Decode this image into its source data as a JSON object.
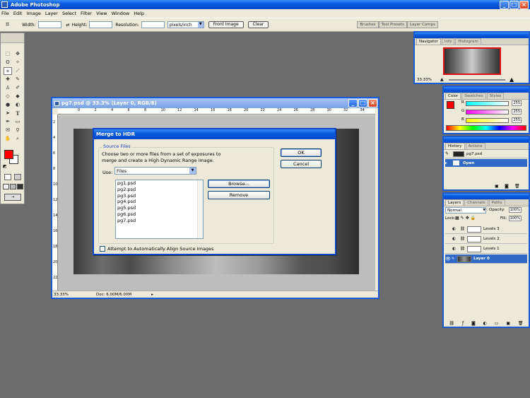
{
  "app": {
    "title": "Adobe Photoshop"
  },
  "menu": [
    "File",
    "Edit",
    "Image",
    "Layer",
    "Select",
    "Filter",
    "View",
    "Window",
    "Help"
  ],
  "options": {
    "width_label": "Width:",
    "height_label": "Height:",
    "resolution_label": "Resolution:",
    "units": "pixels/inch",
    "front_image": "Front Image",
    "clear": "Clear",
    "well_tabs": [
      "Brushes",
      "Tool Presets",
      "Layer Comps"
    ]
  },
  "document": {
    "title": "pg7.psd @ 33.3% (Layer 0, RGB/8)",
    "zoom": "33.33%",
    "doc_info": "Doc: 6.00M/6.00M",
    "ruler_h": [
      "0",
      "2",
      "4",
      "6",
      "8",
      "10",
      "12",
      "14",
      "16",
      "18",
      "20",
      "22",
      "24",
      "26",
      "28",
      "30",
      "32",
      "34"
    ],
    "ruler_v": [
      "2",
      "4",
      "6",
      "8",
      "10",
      "12",
      "14",
      "16",
      "18",
      "20",
      "22"
    ]
  },
  "dialog": {
    "title": "Merge to HDR",
    "group_label": "Source Files",
    "instructions": "Choose two or more files from a set of exposures to merge and create a High Dynamic Range image.",
    "use_label": "Use:",
    "use_value": "Files",
    "files": [
      "pg1.psd",
      "pg2.psd",
      "pg3.psd",
      "pg4.psd",
      "pg5.psd",
      "pg6.psd",
      "pg7.psd"
    ],
    "browse": "Browse...",
    "remove": "Remove",
    "ok": "OK",
    "cancel": "Cancel",
    "align_label": "Attempt to Automatically Align Source Images"
  },
  "navigator": {
    "tabs": [
      "Navigator",
      "Info",
      "Histogram"
    ],
    "zoom": "33.33%"
  },
  "color": {
    "tabs": [
      "Color",
      "Swatches",
      "Styles"
    ],
    "r_label": "R",
    "g_label": "G",
    "b_label": "B",
    "r": "255",
    "g": "255",
    "b": "255",
    "fg_color": "#ff0000"
  },
  "history": {
    "tabs": [
      "History",
      "Actions"
    ],
    "snapshot": "pg7.psd",
    "items": [
      "Open"
    ]
  },
  "layers": {
    "tabs": [
      "Layers",
      "Channels",
      "Paths"
    ],
    "blend_mode": "Normal",
    "opacity_label": "Opacity:",
    "opacity": "100%",
    "lock_label": "Lock:",
    "fill_label": "Fill:",
    "fill": "100%",
    "rows": [
      "Levels 3",
      "Levels 2",
      "Levels 1",
      "Layer 0"
    ]
  }
}
